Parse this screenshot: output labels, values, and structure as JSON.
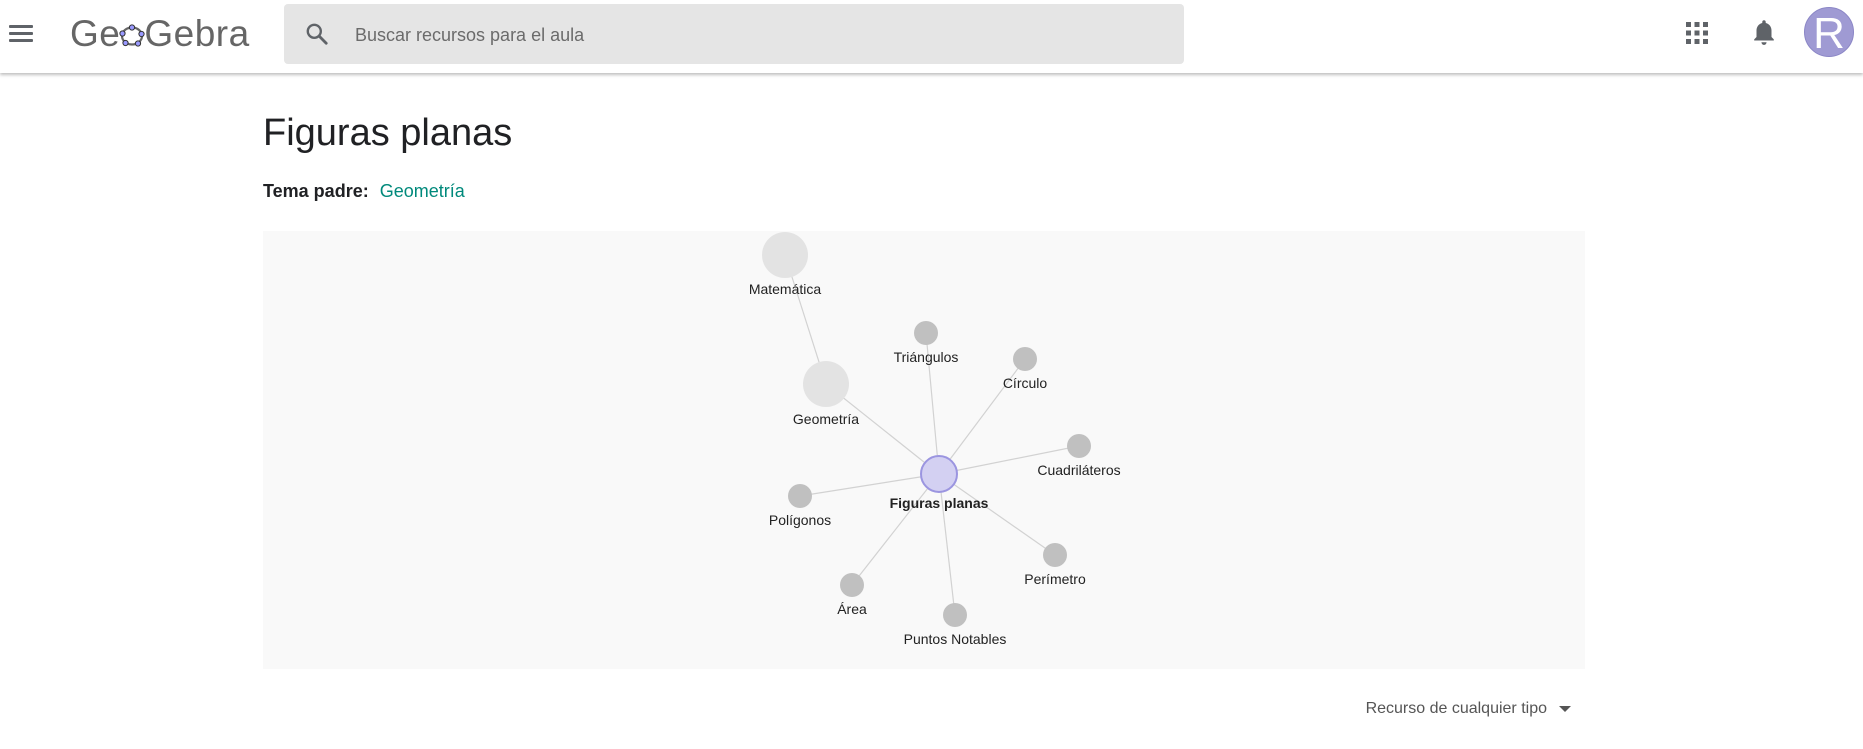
{
  "header": {
    "logo_text": "GeoGebra",
    "search_placeholder": "Buscar recursos para el aula",
    "avatar_letter": "R"
  },
  "page": {
    "title": "Figuras planas",
    "parent_label": "Tema padre:",
    "parent_link": "Geometría"
  },
  "graph": {
    "center": "Figuras planas",
    "nodes": [
      "Matemática",
      "Geometría",
      "Triángulos",
      "Círculo",
      "Cuadriláteros",
      "Polígonos",
      "Perímetro",
      "Área",
      "Puntos Notables"
    ]
  },
  "filter": {
    "label": "Recurso de cualquier tipo"
  }
}
